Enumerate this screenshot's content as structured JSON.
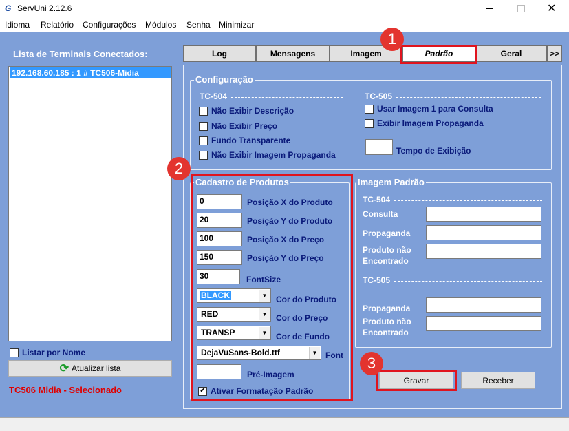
{
  "window": {
    "title": "ServUni 2.12.6",
    "app_icon": "G"
  },
  "menu": [
    "Idioma",
    "Relatório",
    "Configurações",
    "Módulos",
    "Senha",
    "Minimizar"
  ],
  "left": {
    "heading": "Lista de Terminais Conectados:",
    "terminals": [
      "192.168.60.185 : 1 # TC506-Midia"
    ],
    "list_by_name": "Listar por Nome",
    "refresh_button": "Atualizar lista",
    "status": "TC506 Midia - Selecionado"
  },
  "tabs": [
    "Log",
    "Mensagens",
    "Imagem",
    "Padrão",
    "Geral",
    ">>"
  ],
  "config": {
    "title": "Configuração",
    "tc504": "TC-504",
    "tc505": "TC-505",
    "left_checks": [
      "Não Exibir Descrição",
      "Não Exibir Preço",
      "Fundo Transparente",
      "Não Exibir Imagem Propaganda"
    ],
    "right_checks": [
      "Usar Imagem 1 para Consulta",
      "Exibir Imagem Propaganda"
    ],
    "time_label": "Tempo de Exibição",
    "time_value": ""
  },
  "cadastro": {
    "title": "Cadastro de Produtos",
    "fields": [
      {
        "value": "0",
        "label": "Posição X do Produto"
      },
      {
        "value": "20",
        "label": "Posição Y do Produto"
      },
      {
        "value": "100",
        "label": "Posição X do Preço"
      },
      {
        "value": "150",
        "label": "Posição Y do Preço"
      },
      {
        "value": "30",
        "label": "FontSize"
      }
    ],
    "selects": [
      {
        "value": "BLACK",
        "label": "Cor do Produto"
      },
      {
        "value": "RED",
        "label": "Cor do Preço"
      },
      {
        "value": "TRANSP",
        "label": "Cor de Fundo"
      },
      {
        "value": "DejaVuSans-Bold.ttf",
        "label": "Font"
      }
    ],
    "pre_image_label": "Pré-Imagem",
    "pre_image_value": "",
    "default_format": "Ativar Formatação Padrão"
  },
  "imagem_padrao": {
    "title": "Imagem Padrão",
    "tc504": "TC-504",
    "tc505": "TC-505",
    "consulta": "Consulta",
    "propaganda": "Propaganda",
    "nao_encontrado_1": "Produto não",
    "nao_encontrado_2": "Encontrado"
  },
  "buttons": {
    "save": "Gravar",
    "receive": "Receber"
  },
  "annotations": [
    "1",
    "2",
    "3"
  ],
  "colors": {
    "client_bg": "#7e9fd8",
    "annotation_red": "#e0141e",
    "status_red": "#e00000",
    "label_navy": "#0a1a7a"
  }
}
